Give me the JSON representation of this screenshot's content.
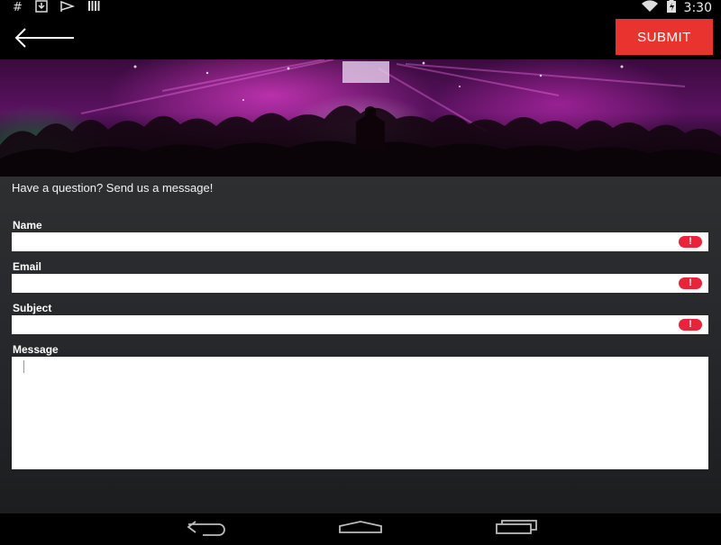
{
  "status_bar": {
    "left_icons": [
      "hash-icon",
      "download-icon",
      "flag-icon",
      "barcode-icon"
    ],
    "time": "3:30"
  },
  "action_bar": {
    "submit_label": "SUBMIT"
  },
  "form": {
    "intro": "Have a question? Send us a message!",
    "fields": {
      "name": {
        "label": "Name",
        "value": ""
      },
      "email": {
        "label": "Email",
        "value": ""
      },
      "subject": {
        "label": "Subject",
        "value": ""
      },
      "message": {
        "label": "Message",
        "value": ""
      }
    },
    "error_indicator": "!"
  },
  "colors": {
    "accent": "#e8332e",
    "error": "#e8233a",
    "background": "#2b2c2e"
  }
}
